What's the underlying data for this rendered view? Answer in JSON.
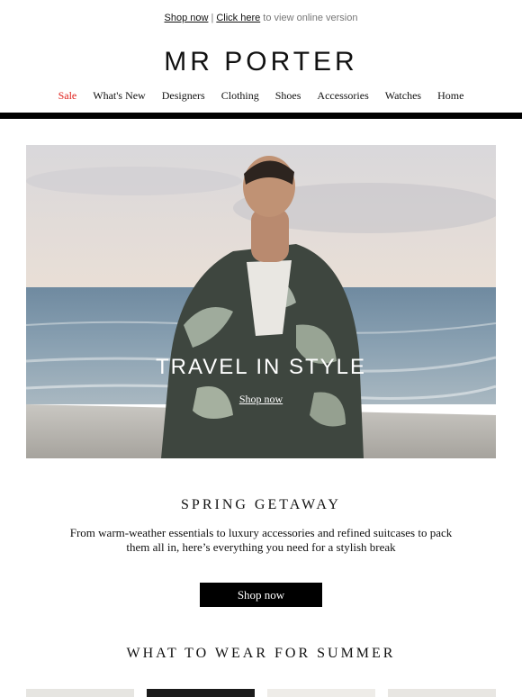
{
  "topbar": {
    "shop_now": "Shop now",
    "separator": "|",
    "click_here": "Click here",
    "suffix": "to view online version"
  },
  "brand": {
    "logo_text": "MR PORTER"
  },
  "nav": {
    "items": [
      "Sale",
      "What's New",
      "Designers",
      "Clothing",
      "Shoes",
      "Accessories",
      "Watches",
      "Home"
    ]
  },
  "hero": {
    "title": "TRAVEL IN STYLE",
    "link": "Shop now"
  },
  "spring": {
    "title": "SPRING GETAWAY",
    "body_line1": "From warm-weather essentials to luxury accessories and refined suitcases to pack",
    "body_line2": "them all in, here’s everything you need for a stylish break",
    "cta": "Shop now"
  },
  "summer": {
    "title": "WHAT TO WEAR FOR SUMMER"
  },
  "colors": {
    "sale": "#e0201b",
    "rule": "#000000",
    "cta_bg": "#000000"
  }
}
